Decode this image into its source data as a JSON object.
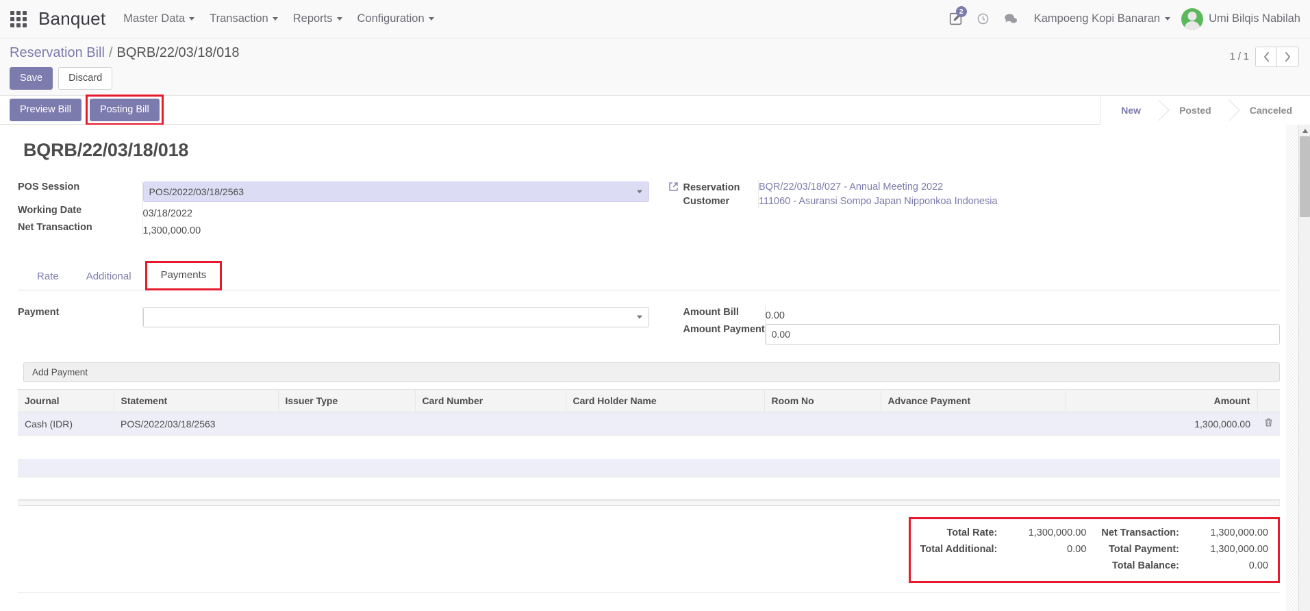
{
  "navbar": {
    "apps_icon": "apps-grid-icon",
    "brand": "Banquet",
    "menus": [
      {
        "label": "Master Data"
      },
      {
        "label": "Transaction"
      },
      {
        "label": "Reports"
      },
      {
        "label": "Configuration"
      }
    ],
    "icons": [
      {
        "name": "edit-note-icon",
        "glyph": "✎",
        "badge": "2"
      },
      {
        "name": "clock-icon",
        "glyph": "◴",
        "badge": ""
      },
      {
        "name": "messages-icon",
        "glyph": "὞9",
        "badge": ""
      }
    ],
    "company": "Kampoeng Kopi Banaran",
    "user": "Umi Bilqis Nabilah"
  },
  "control_panel": {
    "breadcrumb_root": "Reservation Bill",
    "breadcrumb_sep": "/",
    "breadcrumb_current": "BQRB/22/03/18/018",
    "save_label": "Save",
    "discard_label": "Discard",
    "pager_count": "1 / 1",
    "prev_glyph": "‹",
    "next_glyph": "›"
  },
  "action_bar": {
    "preview_bill": "Preview Bill",
    "posting_bill": "Posting Bill",
    "statuses": [
      {
        "label": "New",
        "active": true
      },
      {
        "label": "Posted",
        "active": false
      },
      {
        "label": "Canceled",
        "active": false
      }
    ]
  },
  "form": {
    "record_title": "BQRB/22/03/18/018",
    "left": {
      "pos_session_label": "POS Session",
      "pos_session_value": "POS/2022/03/18/2563",
      "working_date_label": "Working Date",
      "working_date_value": "03/18/2022",
      "net_transaction_label": "Net Transaction",
      "net_transaction_value": "1,300,000.00"
    },
    "right": {
      "reservation_label": "Reservation",
      "reservation_value": "BQR/22/03/18/027 - Annual Meeting 2022",
      "customer_label": "Customer",
      "customer_value": "111060 - Asuransi Sompo Japan Nipponkoa Indonesia"
    }
  },
  "notebook": {
    "tabs": [
      {
        "label": "Rate",
        "active": false
      },
      {
        "label": "Additional",
        "active": false
      },
      {
        "label": "Payments",
        "active": true
      }
    ]
  },
  "payments_tab": {
    "payment_label": "Payment",
    "payment_value": "",
    "payment_placeholder": "",
    "amount_bill_label": "Amount Bill",
    "amount_bill_value": "0.00",
    "amount_payment_label": "Amount Payment",
    "amount_payment_value": "0.00",
    "add_payment_label": "Add Payment",
    "table": {
      "columns": [
        "Journal",
        "Statement",
        "Issuer Type",
        "Card Number",
        "Card Holder Name",
        "Room No",
        "Advance Payment",
        "Amount"
      ],
      "rows": [
        {
          "journal": "Cash (IDR)",
          "statement": "POS/2022/03/18/2563",
          "issuer_type": "",
          "card_number": "",
          "card_holder_name": "",
          "room_no": "",
          "advance_payment": "",
          "amount": "1,300,000.00",
          "delete_glyph": "🗑"
        }
      ]
    }
  },
  "totals": {
    "total_rate_label": "Total Rate:",
    "total_rate_value": "1,300,000.00",
    "total_additional_label": "Total Additional:",
    "total_additional_value": "0.00",
    "net_transaction_label": "Net Transaction:",
    "net_transaction_value": "1,300,000.00",
    "total_payment_label": "Total Payment:",
    "total_payment_value": "1,300,000.00",
    "total_balance_label": "Total Balance:",
    "total_balance_value": "0.00"
  },
  "colors": {
    "accent": "#7c7bad",
    "highlight": "#e8192c",
    "field_focus_bg": "#dddcf5",
    "row_bg": "#eeeef8",
    "avatar_bg": "#5cb85c"
  }
}
